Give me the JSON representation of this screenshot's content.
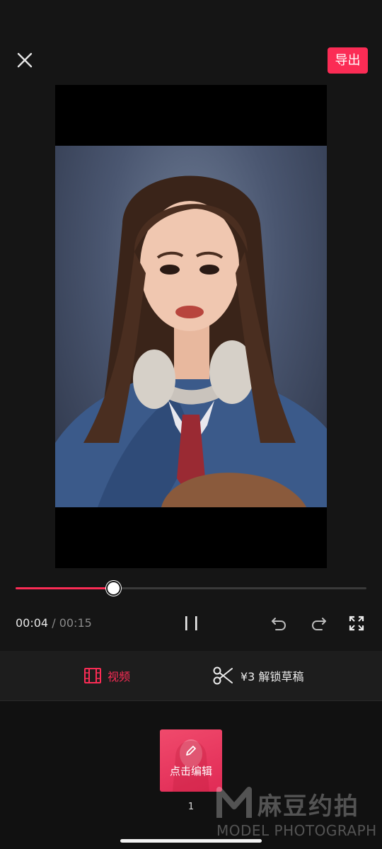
{
  "topbar": {
    "export_label": "导出"
  },
  "playback": {
    "current_time": "00:04",
    "separator": "/",
    "duration": "00:15",
    "progress_fraction": 0.277
  },
  "toolbar": {
    "video_label": "视频",
    "unlock_label": "¥3 解锁草稿"
  },
  "timeline": {
    "clip_label": "点击编辑",
    "clip_index": "1"
  },
  "watermark": {
    "brand_cn": "麻豆约拍",
    "brand_en": "MODEL PHOTOGRAPH"
  },
  "colors": {
    "accent": "#fb2c55",
    "background": "#151515"
  },
  "icons": [
    "close-icon",
    "pause-icon",
    "undo-icon",
    "redo-icon",
    "fullscreen-icon",
    "film-icon",
    "scissors-icon",
    "pencil-icon"
  ]
}
